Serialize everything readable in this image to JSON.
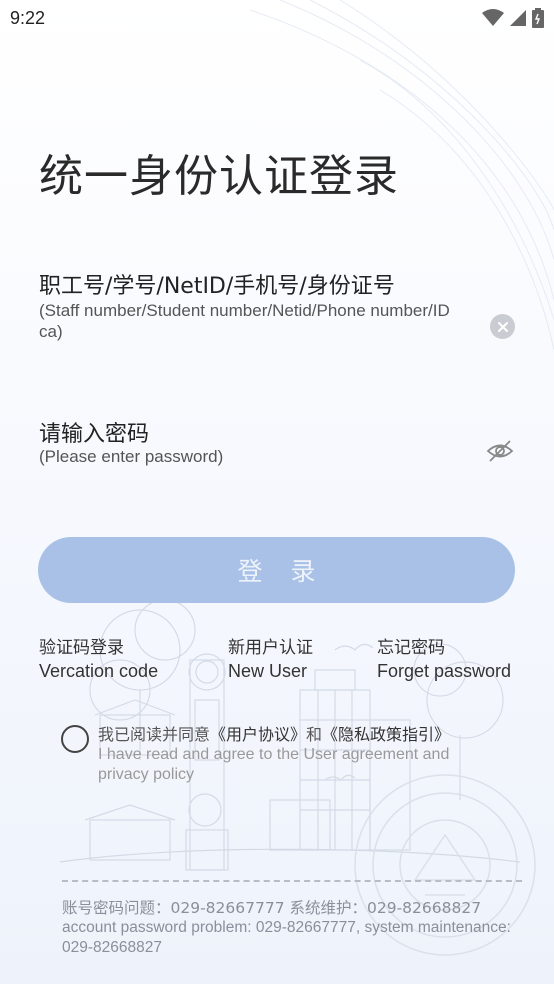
{
  "status_bar": {
    "time": "9:22"
  },
  "title": "统一身份认证登录",
  "username": {
    "label": "职工号/学号/NetID/手机号/身份证号",
    "sub_line1": "(Staff number/Student number/Netid/Phone number/ID",
    "sub_line2": "ca)"
  },
  "password": {
    "label": "请输入密码",
    "sub": "(Please enter password)"
  },
  "login_button": "登 录",
  "links": [
    {
      "cn": "验证码登录",
      "en": "Vercation code"
    },
    {
      "cn": "新用户认证",
      "en": "New User"
    },
    {
      "cn": "忘记密码",
      "en": "Forget password"
    }
  ],
  "agreement": {
    "prefix": "我已阅读并同意",
    "user_agreement": "《用户协议》",
    "and": "和",
    "privacy_policy": "《隐私政策指引》",
    "en": "I have read and agree to the User agreement and privacy policy"
  },
  "footer": {
    "cn": "账号密码问题：029-82667777 系统维护：029-82668827",
    "en": "account password problem: 029-82667777, system maintenance: 029-82668827"
  },
  "colors": {
    "button_bg": "#a9c1e6",
    "button_text": "#eef3fb",
    "background": "#f7f9fe"
  },
  "icons": [
    "wifi-icon",
    "signal-icon",
    "battery-icon",
    "clear-icon",
    "eye-off-icon",
    "campus-illustration",
    "university-seal"
  ]
}
